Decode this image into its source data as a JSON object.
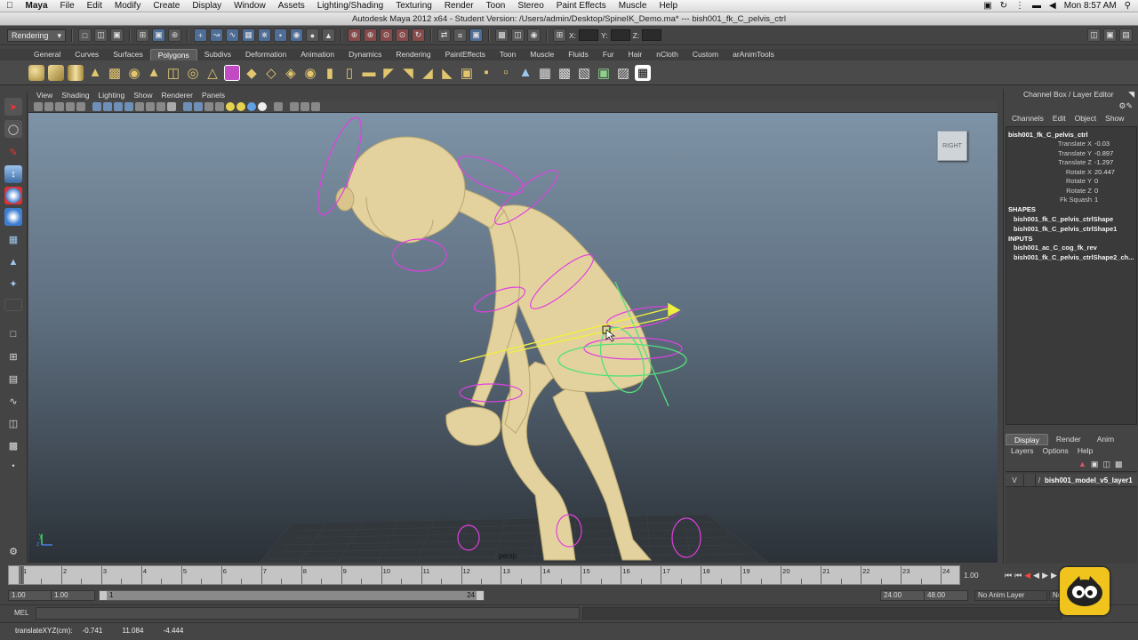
{
  "mac_menu": {
    "apple": "",
    "app": "Maya",
    "items": [
      "File",
      "Edit",
      "Modify",
      "Create",
      "Display",
      "Window",
      "Assets",
      "Lighting/Shading",
      "Texturing",
      "Render",
      "Toon",
      "Stereo",
      "Paint Effects",
      "Muscle",
      "Help"
    ],
    "clock": "Mon 8:57 AM"
  },
  "window_title": "Autodesk Maya 2012 x64 - Student Version: /Users/admin/Desktop/SpineIK_Demo.ma*  ---  bish001_fk_C_pelvis_ctrl",
  "status_line": {
    "menu_set": "Rendering",
    "x_label": "X:",
    "y_label": "Y:",
    "z_label": "Z:"
  },
  "shelf_tabs": [
    "General",
    "Curves",
    "Surfaces",
    "Polygons",
    "Subdivs",
    "Deformation",
    "Animation",
    "Dynamics",
    "Rendering",
    "PaintEffects",
    "Toon",
    "Muscle",
    "Fluids",
    "Fur",
    "Hair",
    "nCloth",
    "Custom",
    "arAnimTools"
  ],
  "shelf_active": "Polygons",
  "viewport": {
    "menu": [
      "View",
      "Shading",
      "Lighting",
      "Show",
      "Renderer",
      "Panels"
    ],
    "view_cube_label": "RIGHT",
    "camera_label": "persp",
    "axis_y": "y",
    "axis_z": "z"
  },
  "channel_box": {
    "title": "Channel Box / Layer Editor",
    "menu": [
      "Channels",
      "Edit",
      "Object",
      "Show"
    ],
    "object": "bish001_fk_C_pelvis_ctrl",
    "channels": [
      {
        "name": "Translate X",
        "value": "-0.03"
      },
      {
        "name": "Translate Y",
        "value": "-0.897"
      },
      {
        "name": "Translate Z",
        "value": "-1.297"
      },
      {
        "name": "Rotate X",
        "value": "20.447"
      },
      {
        "name": "Rotate Y",
        "value": "0"
      },
      {
        "name": "Rotate Z",
        "value": "0"
      },
      {
        "name": "Fk Squash",
        "value": "1"
      }
    ],
    "shapes_label": "SHAPES",
    "shapes": [
      "bish001_fk_C_pelvis_ctrlShape",
      "bish001_fk_C_pelvis_ctrlShape1"
    ],
    "inputs_label": "INPUTS",
    "inputs": [
      "bish001_ac_C_cog_fk_rev",
      "bish001_fk_C_pelvis_ctrlShape2_ch..."
    ]
  },
  "layer_editor": {
    "tabs": [
      "Display",
      "Render",
      "Anim"
    ],
    "active_tab": "Display",
    "menu": [
      "Layers",
      "Options",
      "Help"
    ],
    "layer": {
      "visibility": "V",
      "name": "bish001_model_v5_layer1"
    }
  },
  "time_slider": {
    "ticks": [
      "1",
      "2",
      "3",
      "4",
      "5",
      "6",
      "7",
      "8",
      "9",
      "10",
      "11",
      "12",
      "13",
      "14",
      "15",
      "16",
      "17",
      "18",
      "19",
      "20",
      "21",
      "22",
      "23",
      "24"
    ],
    "current_frame": "1.00"
  },
  "range_slider": {
    "start_time": "1.00",
    "playback_start": "1.00",
    "range_start": "1",
    "range_end": "24",
    "playback_end": "24.00",
    "end_time": "48.00",
    "anim_layer": "No Anim Layer",
    "char_set": "No"
  },
  "command_line": {
    "label": "MEL"
  },
  "help_line": {
    "label": "translateXYZ(cm):",
    "x": "-0.741",
    "y": "11.084",
    "z": "-4.444"
  },
  "colors": {
    "accent": "#5b7ea8",
    "selection": "#e040e0",
    "viewport_top": "#7e93a6"
  }
}
